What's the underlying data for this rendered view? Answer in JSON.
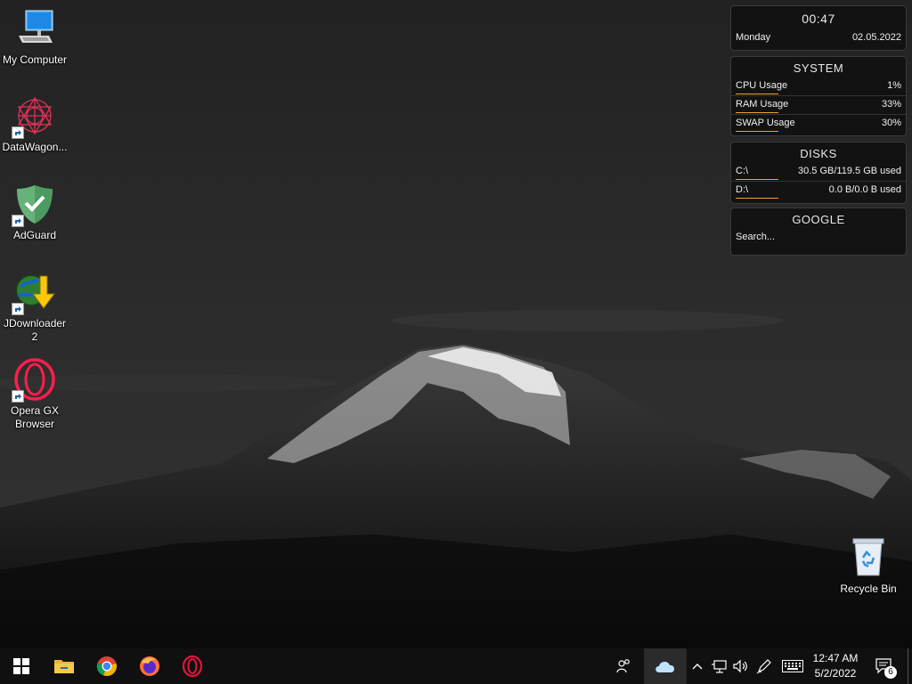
{
  "desktop": {
    "icons": [
      {
        "label": "My Computer"
      },
      {
        "label": "DataWagon..."
      },
      {
        "label": "AdGuard"
      },
      {
        "label": "JDownloader 2"
      },
      {
        "label": "Opera GX Browser"
      },
      {
        "label": "Recycle Bin"
      }
    ]
  },
  "widgets": {
    "clock": {
      "time": "00:47",
      "day": "Monday",
      "date": "02.05.2022"
    },
    "system": {
      "title": "SYSTEM",
      "rows": [
        {
          "label": "CPU Usage",
          "value": "1%",
          "fraction": 0.01
        },
        {
          "label": "RAM Usage",
          "value": "33%",
          "fraction": 0.33
        },
        {
          "label": "SWAP Usage",
          "value": "30%",
          "fraction": 0.3
        }
      ]
    },
    "disks": {
      "title": "DISKS",
      "rows": [
        {
          "label": "C:\\",
          "value": "30.5 GB/119.5 GB used",
          "fraction": 0.255
        },
        {
          "label": "D:\\",
          "value": "0.0 B/0.0 B used",
          "fraction": 0
        }
      ]
    },
    "google": {
      "title": "GOOGLE",
      "search_placeholder": "Search..."
    }
  },
  "taskbar": {
    "pinned": [
      "start-icon",
      "file-explorer-icon",
      "chrome-icon",
      "firefox-icon",
      "opera-icon"
    ],
    "time": "12:47 AM",
    "date": "5/2/2022",
    "notification_count": "6"
  },
  "colors": {
    "accent_bar": "#f0a033",
    "taskbar": "#101010"
  }
}
